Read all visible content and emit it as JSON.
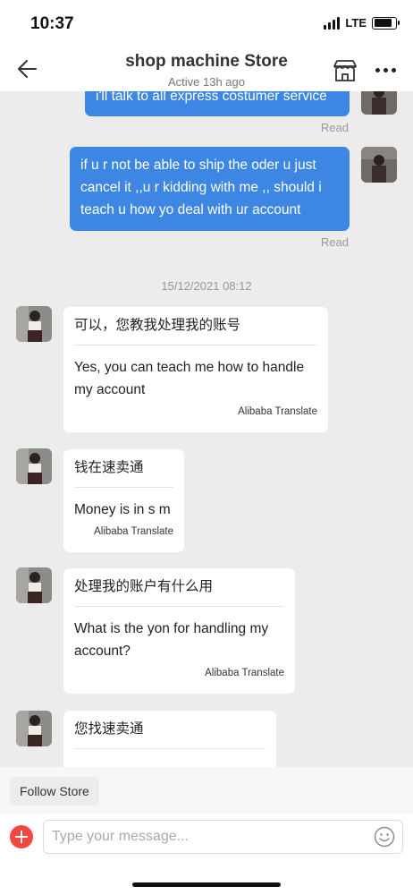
{
  "status_bar": {
    "time": "10:37",
    "network": "LTE"
  },
  "header": {
    "title": "shop machine Store",
    "subtitle": "Active 13h ago"
  },
  "messages_sent": [
    {
      "text": "i'll talk to all express costumer service",
      "status": "Read"
    },
    {
      "text": "if u  r not be able to ship the oder u just cancel it ,,u r kidding with me ,, should i teach u how yo deal with ur account",
      "status": "Read"
    }
  ],
  "date_separator": "15/12/2021 08:12",
  "messages_received": [
    {
      "original": "可以，您教我处理我的账号",
      "translated": "Yes, you can teach me how to handle my account",
      "translation_source": "Alibaba Translate"
    },
    {
      "original": "钱在速卖通",
      "translated": "Money is in s m",
      "translation_source": "Alibaba Translate"
    },
    {
      "original": "处理我的账户有什么用",
      "translated": "What is the yon for handling my account?",
      "translation_source": "Alibaba Translate"
    },
    {
      "original": "您找速卖通"
    }
  ],
  "footer": {
    "follow_label": "Follow Store",
    "input_placeholder": "Type your message..."
  },
  "colors": {
    "sent_bubble": "#3d86e3",
    "add_button": "#f0483e",
    "chat_background": "#ececec"
  }
}
